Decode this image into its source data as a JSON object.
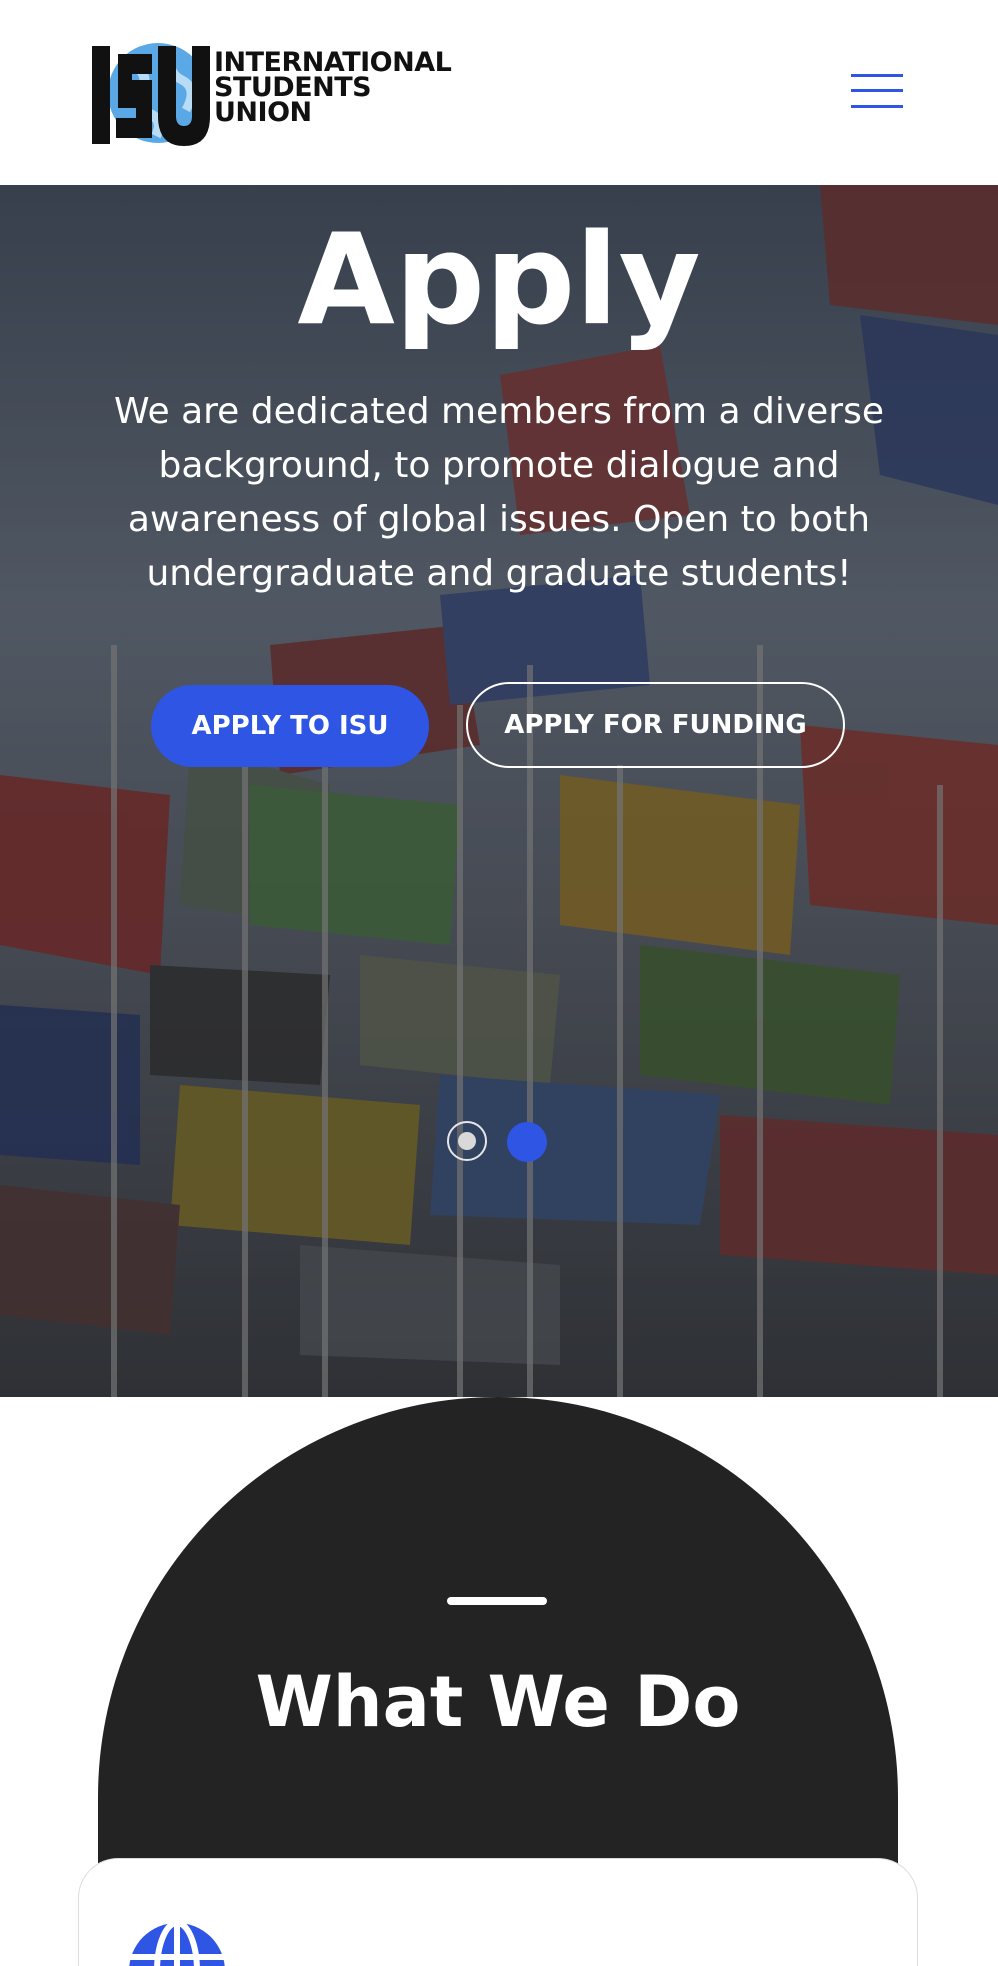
{
  "header": {
    "logo": {
      "mark": "ISU",
      "lines": [
        "INTERNATIONAL",
        "STUDENTS",
        "UNION"
      ]
    },
    "menu_icon": "hamburger-menu-icon"
  },
  "hero": {
    "title": "Apply",
    "description": "We are dedicated members from a diverse background, to promote dialogue and awareness of global issues. Open to both undergraduate and graduate students!",
    "primary_button": "APPLY TO ISU",
    "secondary_button": "APPLY FOR FUNDING",
    "slides": {
      "count": 2,
      "active": 2
    }
  },
  "what_we_do": {
    "title": "What We Do",
    "card_icon": "globe-icon"
  },
  "colors": {
    "accent": "#2f55e4",
    "dark_section": "#232323",
    "header_bg": "#ffffff"
  }
}
